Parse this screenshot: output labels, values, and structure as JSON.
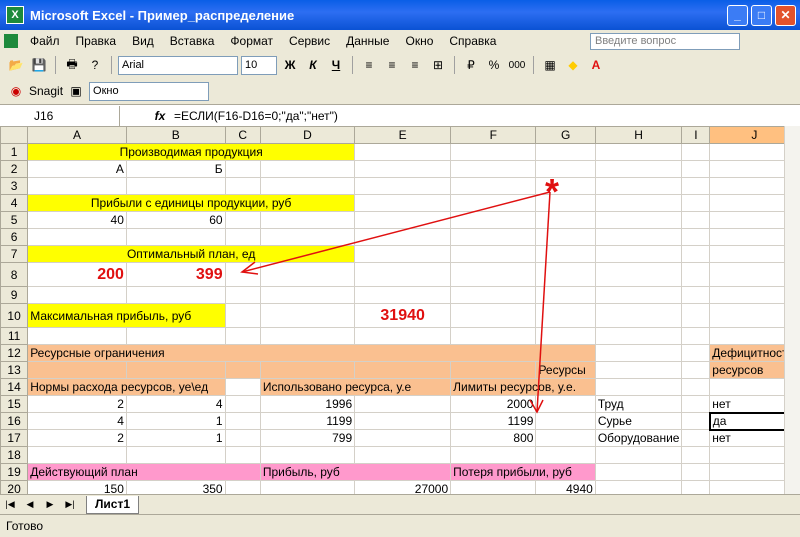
{
  "window": {
    "title": "Microsoft Excel - Пример_распределение"
  },
  "menu": [
    "Файл",
    "Правка",
    "Вид",
    "Вставка",
    "Формат",
    "Сервис",
    "Данные",
    "Окно",
    "Справка"
  ],
  "ask_placeholder": "Введите вопрос",
  "toolbar": {
    "font": "Arial",
    "size": "10",
    "bold": "Ж",
    "italic": "К",
    "underline": "Ч",
    "percent": "%",
    "thousands": "000"
  },
  "toolbar2": {
    "snagit": "Snagit",
    "window": "Окно"
  },
  "formula": {
    "cell": "J16",
    "fx": "fx",
    "text": "=ЕСЛИ(F16-D16=0;\"да\";\"нет\")"
  },
  "columns": [
    "A",
    "B",
    "C",
    "D",
    "E",
    "F",
    "G",
    "H",
    "I",
    "J"
  ],
  "cells": {
    "r1": "Производимая продукция",
    "r2a": "А",
    "r2b": "Б",
    "r4": "Прибыли с единицы продукции, руб",
    "r5a": "40",
    "r5b": "60",
    "r7": "Оптимальный план, ед",
    "r8a": "200",
    "r8b": "399",
    "r10a": "Максимальная прибыль, руб",
    "r10e": "31940",
    "r12a": "Ресурсные ограничения",
    "r12j": "Дефицитность",
    "r13h": "Ресурсы",
    "r13j": "ресурсов",
    "r14a": "Нормы расхода ресурсов, уе\\ед",
    "r14d": "Использовано ресурса, у.е",
    "r14f": "Лимиты ресурсов, у.е.",
    "r15a": "2",
    "r15b": "4",
    "r15d": "1996",
    "r15f": "2000",
    "r15h": "Труд",
    "r15j": "нет",
    "r16a": "4",
    "r16b": "1",
    "r16d": "1199",
    "r16f": "1199",
    "r16h": "Сурье",
    "r16j": "да",
    "r17a": "2",
    "r17b": "1",
    "r17d": "799",
    "r17f": "800",
    "r17h": "Оборудование",
    "r17j": "нет",
    "r19a": "Действующий план",
    "r19d": "Прибыль, руб",
    "r19f": "Потеря прибыли, руб",
    "r20a": "150",
    "r20b": "350",
    "r20e": "27000",
    "r20g": "4940"
  },
  "annotation": "*",
  "sheet_tab": "Лист1",
  "status": "Готово"
}
